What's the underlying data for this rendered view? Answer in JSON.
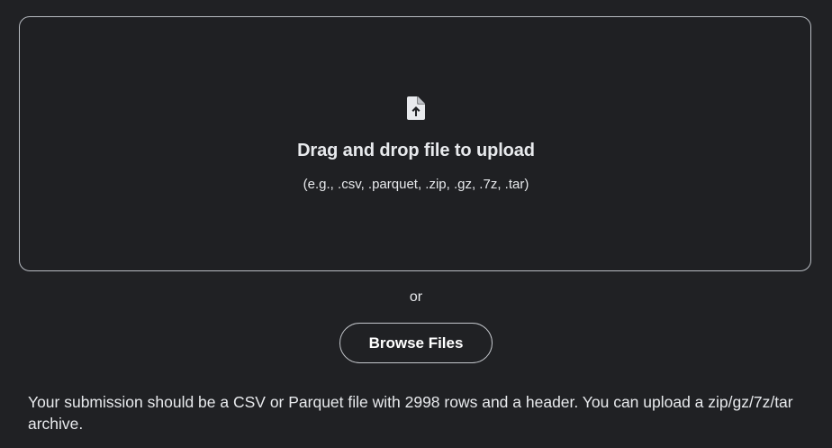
{
  "dropzone": {
    "icon": "file-upload-icon",
    "title": "Drag and drop file to upload",
    "hint": "(e.g., .csv, .parquet, .zip, .gz, .7z, .tar)"
  },
  "divider_text": "or",
  "browse_button": {
    "label": "Browse Files"
  },
  "requirements_note": "Your submission should be a CSV or Parquet file with 2998 rows and a header. You can upload a zip/gz/7z/tar archive.",
  "colors": {
    "background": "#202124",
    "text": "#e8eaed",
    "border": "#b8bcc2"
  }
}
